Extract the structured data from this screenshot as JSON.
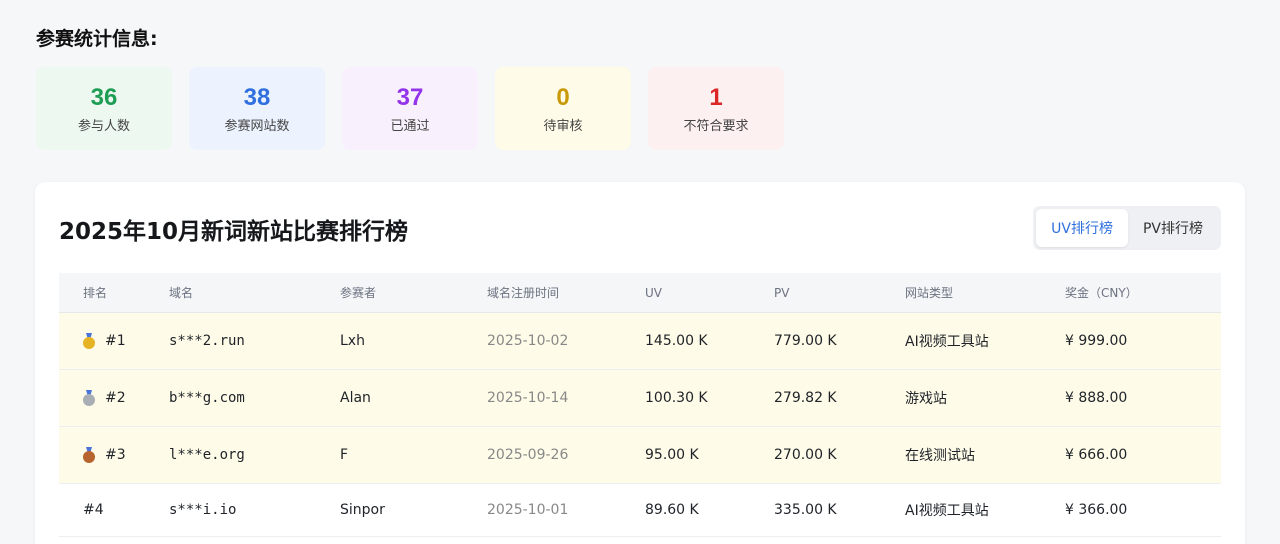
{
  "stats": {
    "title": "参赛统计信息:",
    "cards": [
      {
        "value": "36",
        "label": "参与人数",
        "color": "#1f9d55",
        "bg": "#edf8f0"
      },
      {
        "value": "38",
        "label": "参赛网站数",
        "color": "#2f6fde",
        "bg": "#ecf3fe"
      },
      {
        "value": "37",
        "label": "已通过",
        "color": "#9333ea",
        "bg": "#f8f1fd"
      },
      {
        "value": "0",
        "label": "待审核",
        "color": "#c99a06",
        "bg": "#fefbe8"
      },
      {
        "value": "1",
        "label": "不符合要求",
        "color": "#dc2626",
        "bg": "#fdf0f0"
      }
    ]
  },
  "leaderboard": {
    "title": "2025年10月新词新站比赛排行榜",
    "tabs": [
      {
        "label": "UV排行榜",
        "active": true
      },
      {
        "label": "PV排行榜",
        "active": false
      }
    ],
    "columns": [
      "排名",
      "域名",
      "参赛者",
      "域名注册时间",
      "UV",
      "PV",
      "网站类型",
      "奖金（CNY）"
    ],
    "rows": [
      {
        "rank": "#1",
        "medal": "gold-medal-icon",
        "medal_color": "#e6b325",
        "domain": "s***2.run",
        "participant": "Lxh",
        "reg_date": "2025-10-02",
        "uv": "145.00 K",
        "pv": "779.00 K",
        "type": "AI视频工具站",
        "prize": "¥ 999.00"
      },
      {
        "rank": "#2",
        "medal": "silver-medal-icon",
        "medal_color": "#a9adb4",
        "domain": "b***g.com",
        "participant": "Alan",
        "reg_date": "2025-10-14",
        "uv": "100.30 K",
        "pv": "279.82 K",
        "type": "游戏站",
        "prize": "¥ 888.00"
      },
      {
        "rank": "#3",
        "medal": "bronze-medal-icon",
        "medal_color": "#b8642e",
        "domain": "l***e.org",
        "participant": "F",
        "reg_date": "2025-09-26",
        "uv": "95.00 K",
        "pv": "270.00 K",
        "type": "在线测试站",
        "prize": "¥ 666.00"
      },
      {
        "rank": "#4",
        "medal": "",
        "medal_color": "",
        "domain": "s***i.io",
        "participant": "Sinpor",
        "reg_date": "2025-10-01",
        "uv": "89.60 K",
        "pv": "335.00 K",
        "type": "AI视频工具站",
        "prize": "¥ 366.00"
      }
    ]
  }
}
